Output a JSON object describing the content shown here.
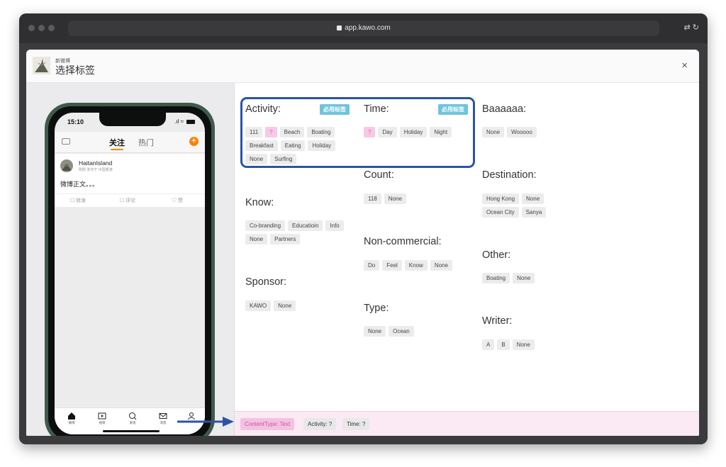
{
  "browser": {
    "url": "app.kawo.com",
    "colors": {
      "dot": "#5b5b5e"
    }
  },
  "modal": {
    "subtitle": "新微博",
    "title": "选择标签",
    "close_icon": "×"
  },
  "phone": {
    "time": "15:10",
    "tabs": [
      "关注",
      "热门"
    ],
    "plus": "+",
    "post": {
      "name": "HaitanIsland",
      "meta": "刚刚  发布于 中国香港",
      "text": "微博正文。。。",
      "actions": [
        "转发",
        "评论",
        "赞"
      ]
    },
    "nav": [
      "微博",
      "视频",
      "发现",
      "消息",
      ""
    ]
  },
  "groups": {
    "activity": {
      "title": "Activity:",
      "required": "必用标签",
      "tags": [
        "111",
        "?",
        "Beach",
        "Boating",
        "Breakfast",
        "Eating",
        "Holiday",
        "None",
        "Surfing"
      ]
    },
    "time": {
      "title": "Time:",
      "required": "必用标签",
      "tags": [
        "?",
        "Day",
        "Holiday",
        "Night"
      ]
    },
    "baaaaaa": {
      "title": "Baaaaaa:",
      "tags": [
        "None",
        "Wooooo"
      ]
    },
    "count": {
      "title": "Count:",
      "tags": [
        "118",
        "None"
      ]
    },
    "destination": {
      "title": "Destination:",
      "tags": [
        "Hong Kong",
        "None",
        "Ocean City",
        "Sanya"
      ]
    },
    "know": {
      "title": "Know:",
      "tags": [
        "Co-branding",
        "Educatioin",
        "Info",
        "None",
        "Partners"
      ]
    },
    "noncommercial": {
      "title": "Non-commercial:",
      "tags": [
        "Do",
        "Feel",
        "Know",
        "None"
      ]
    },
    "other": {
      "title": "Other:",
      "tags": [
        "Boating",
        "None"
      ]
    },
    "sponsor": {
      "title": "Sponsor:",
      "tags": [
        "KAWO",
        "None"
      ]
    },
    "type": {
      "title": "Type:",
      "tags": [
        "None",
        "Ocean"
      ]
    },
    "writer": {
      "title": "Writer:",
      "tags": [
        "A",
        "B",
        "None"
      ]
    }
  },
  "footer": {
    "chips": [
      "ContentType: Text",
      "Activity: ?",
      "Time: ?"
    ]
  },
  "colors": {
    "required_badge": "#6ec4dc",
    "question_tag": "#f6c9e6",
    "highlight_box": "#2b53a6",
    "arrow": "#2b53a6",
    "weibo_orange": "#ff8200"
  }
}
